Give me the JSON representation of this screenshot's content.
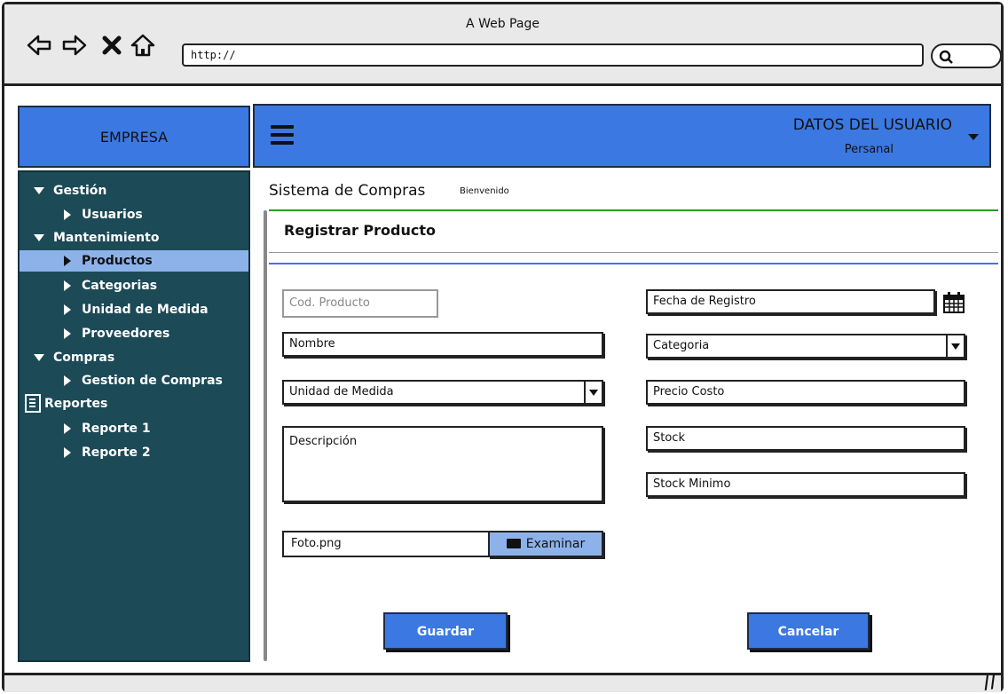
{
  "window": {
    "title": "A Web Page",
    "url": "http://"
  },
  "header": {
    "brand": "EMPRESA",
    "user_name": "DATOS DEL USUARIO",
    "user_role": "Persanal"
  },
  "sidebar": {
    "items": [
      {
        "label": "Gestión",
        "level": 0,
        "icon": "triangle-down"
      },
      {
        "label": "Usuarios",
        "level": 1,
        "icon": "triangle-right"
      },
      {
        "label": "Mantenimiento",
        "level": 0,
        "icon": "triangle-down"
      },
      {
        "label": "Productos",
        "level": 1,
        "icon": "triangle-right",
        "selected": true
      },
      {
        "label": "Categorias",
        "level": 1,
        "icon": "triangle-right"
      },
      {
        "label": "Unidad de Medida",
        "level": 1,
        "icon": "triangle-right"
      },
      {
        "label": "Proveedores",
        "level": 1,
        "icon": "triangle-right"
      },
      {
        "label": "Compras",
        "level": 0,
        "icon": "triangle-down"
      },
      {
        "label": "Gestion de Compras",
        "level": 1,
        "icon": "triangle-right"
      },
      {
        "label": "Reportes",
        "level": 0,
        "icon": "document"
      },
      {
        "label": "Reporte 1",
        "level": 1,
        "icon": "triangle-right"
      },
      {
        "label": "Reporte 2",
        "level": 1,
        "icon": "triangle-right"
      }
    ]
  },
  "main": {
    "system_title": "Sistema de Compras",
    "welcome": "Bienvenido",
    "form_title": "Registrar Producto",
    "fields": {
      "cod_producto": "Cod. Producto",
      "nombre": "Nombre",
      "unidad_medida": "Unidad de Medida",
      "descripcion": "Descripción",
      "foto": "Foto.png",
      "examinar": "Examinar",
      "fecha_registro": "Fecha de Registro",
      "categoria": "Categoria",
      "precio_costo": "Precio Costo",
      "stock": "Stock",
      "stock_minimo": "Stock Minimo"
    },
    "buttons": {
      "guardar": "Guardar",
      "cancelar": "Cancelar"
    }
  },
  "colors": {
    "accent_blue": "#3b78e2",
    "sidebar_bg": "#1c4a57",
    "selected_bg": "#8db2ea",
    "success_line": "#2a9a2a"
  }
}
